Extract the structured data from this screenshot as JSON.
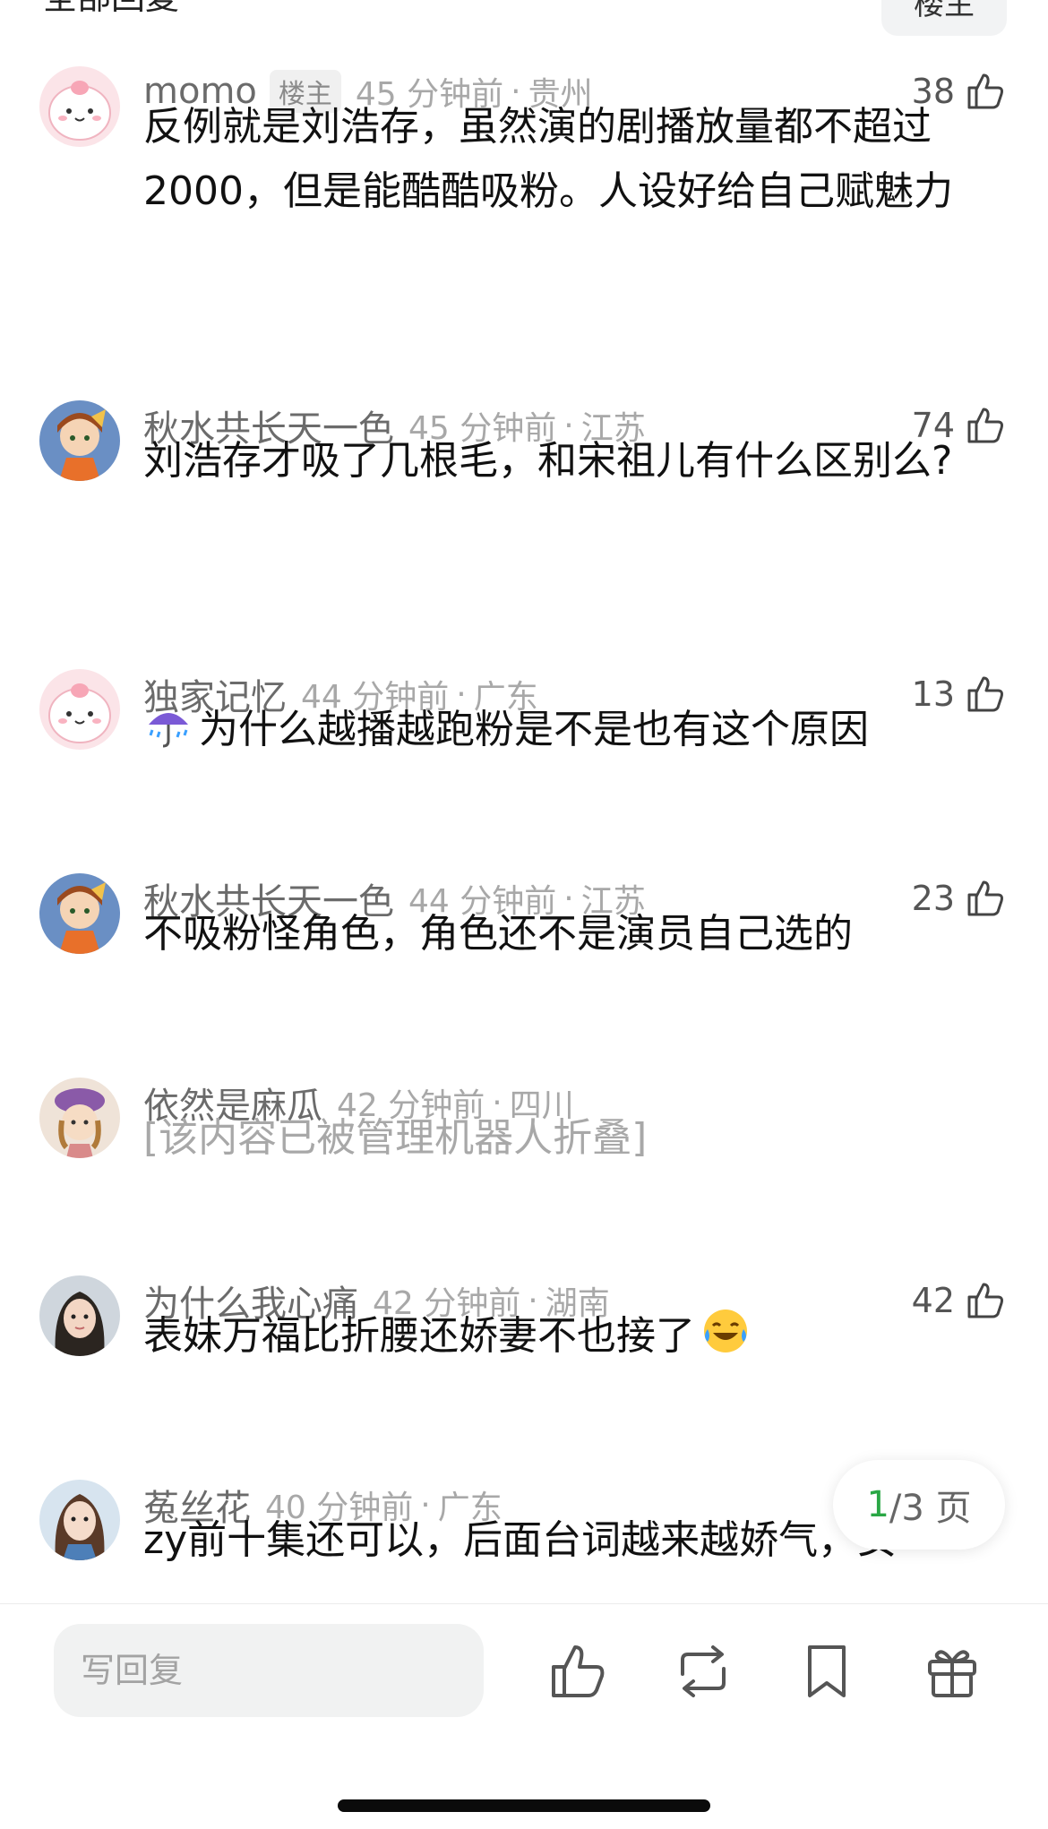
{
  "header": {
    "title": "全部回复",
    "button": "楼主"
  },
  "comments": [
    {
      "username": "momo",
      "badge": "楼主",
      "time": "45 分钟前",
      "sep": "·",
      "location": "贵州",
      "likes": "38",
      "text": "反例就是刘浩存，虽然演的剧播放量都不超过2000，但是能酷酷吸粉。人设好给自己赋魅力",
      "avatar_icon": "pink-cartoon-avatar"
    },
    {
      "username": "秋水共长天一色",
      "time": "45 分钟前",
      "sep": "·",
      "location": "江苏",
      "likes": "74",
      "text": "刘浩存才吸了几根毛，和宋祖儿有什么区别么?",
      "avatar_icon": "anime-girl-avatar"
    },
    {
      "username": "独家记忆",
      "time": "44 分钟前",
      "sep": "·",
      "location": "广东",
      "likes": "13",
      "text": "为什么越播越跑粉是不是也有这个原因",
      "emoji": "umbrella-rain-emoji",
      "avatar_icon": "pink-cartoon-avatar"
    },
    {
      "username": "秋水共长天一色",
      "time": "44 分钟前",
      "sep": "·",
      "location": "江苏",
      "likes": "23",
      "text": "不吸粉怪角色，角色还不是演员自己选的",
      "avatar_icon": "anime-girl-avatar"
    },
    {
      "username": "依然是麻瓜",
      "time": "42 分钟前",
      "sep": "·",
      "location": "四川",
      "text": "[该内容已被管理机器人折叠]",
      "avatar_icon": "purple-hat-girl-avatar"
    },
    {
      "username": "为什么我心痛",
      "time": "42 分钟前",
      "sep": "·",
      "location": "湖南",
      "likes": "42",
      "text": "表妹万福比折腰还娇妻不也接了",
      "emoji": "laughing-tears-emoji",
      "avatar_icon": "photo-girl-avatar"
    },
    {
      "username": "菟丝花",
      "time": "40 分钟前",
      "sep": "·",
      "location": "广东",
      "text": "zy前十集还可以，后面台词越来越娇气，女",
      "avatar_icon": "photo-girl-blue-avatar"
    }
  ],
  "pager": {
    "current": "1",
    "total": "/3 页"
  },
  "bottom_bar": {
    "reply_placeholder": "写回复",
    "icons": [
      "thumbs-up-icon",
      "repost-icon",
      "bookmark-icon",
      "gift-icon"
    ]
  },
  "colors": {
    "accent_green": "#2aa745",
    "meta_gray": "#a8a8a8",
    "input_bg": "#f1f2f2"
  }
}
